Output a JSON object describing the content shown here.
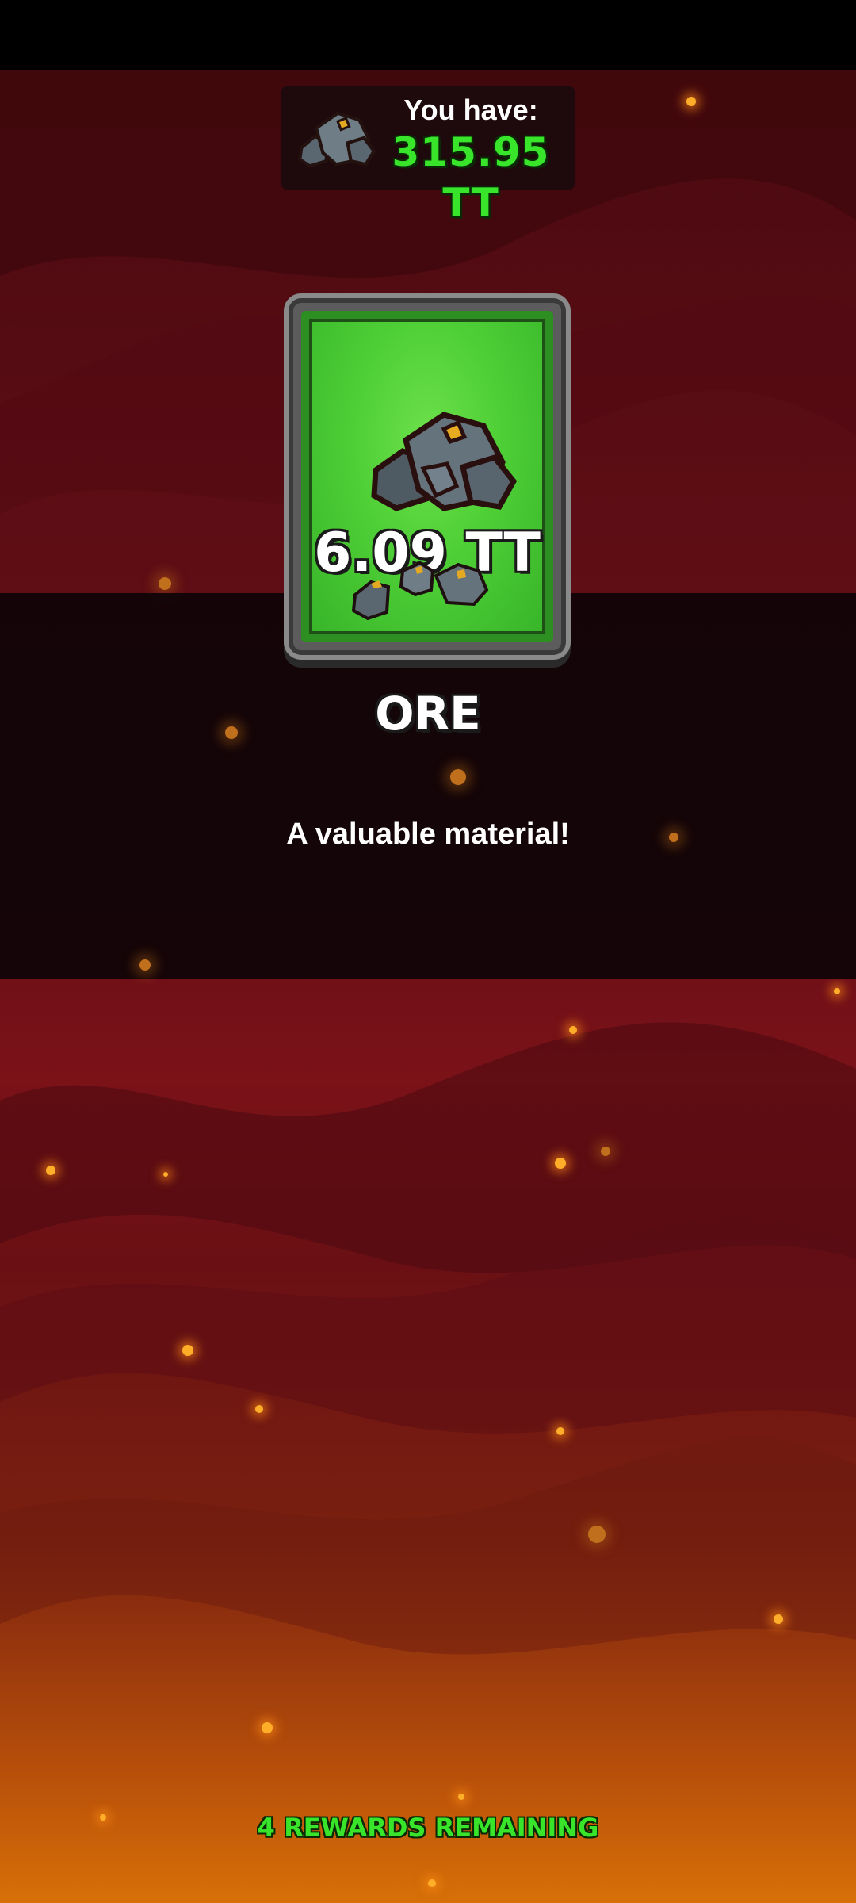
{
  "currency": {
    "label": "You have:",
    "amount": "315.95 TT",
    "icon": "ore-rock-icon"
  },
  "reward": {
    "amount": "6.09 TT",
    "title": "ORE",
    "description": "A valuable material!",
    "icon": "ore-rock-icon"
  },
  "footer": {
    "remaining": "4 REWARDS REMAINING"
  },
  "colors": {
    "accent_green": "#39e52b",
    "card_green": "#4fcf36",
    "background_red": "#6a0f18",
    "background_orange": "#d77008"
  }
}
